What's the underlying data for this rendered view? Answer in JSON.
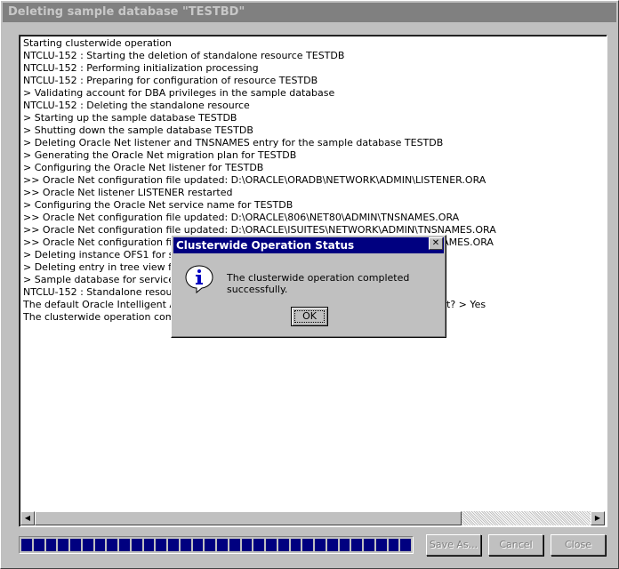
{
  "window": {
    "title": "Deleting sample database \"TESTBD\""
  },
  "log": {
    "lines": [
      "Starting clusterwide operation",
      "NTCLU-152 : Starting the deletion of standalone resource TESTDB",
      "NTCLU-152 : Performing initialization processing",
      "NTCLU-152 : Preparing for configuration of resource TESTDB",
      " > Validating account  for DBA privileges in the sample database",
      "NTCLU-152 : Deleting the standalone resource",
      " > Starting up the sample database TESTDB",
      " > Shutting down the sample database TESTDB",
      " > Deleting Oracle Net listener and TNSNAMES entry for the sample database TESTDB",
      " > Generating the Oracle Net migration plan for TESTDB",
      " > Configuring the Oracle Net listener for TESTDB",
      " >> Oracle Net configuration file updated: D:\\ORACLE\\ORADB\\NETWORK\\ADMIN\\LISTENER.ORA",
      " >> Oracle Net listener LISTENER restarted",
      " > Configuring the Oracle Net service name for TESTDB",
      " >> Oracle Net configuration file updated: D:\\ORACLE\\806\\NET80\\ADMIN\\TNSNAMES.ORA",
      " >> Oracle Net configuration file updated: D:\\ORACLE\\ISUITES\\NETWORK\\ADMIN\\TNSNAMES.ORA",
      " >> Oracle Net configuration file updated: D:\\ORACLE\\ORADB\\NETWORK\\ADMIN\\TNSNAMES.ORA",
      " > Deleting instance OFS1 for sample database TESTDB",
      " > Deleting entry in tree view for sample database TESTDB",
      " > Sample database for service name TESTDB deleted",
      "NTCLU-152 : Standalone resource TESTDB deleted",
      "The default Oracle Intelligent Agent for the cluster is stopped. Do you want to restart it? > Yes",
      "The clusterwide operation completed successfully."
    ]
  },
  "progress": {
    "value_percent": 100,
    "blocks": 32,
    "color": "#000080"
  },
  "buttons": {
    "save_as": "Save As...",
    "cancel": "Cancel",
    "close": "Close"
  },
  "dialog": {
    "title": "Clusterwide Operation Status",
    "message": "The clusterwide operation completed successfully.",
    "ok": "OK",
    "close_glyph": "✕",
    "icon": "info-icon"
  },
  "scrollbar": {
    "left_glyph": "◀",
    "right_glyph": "▶"
  }
}
